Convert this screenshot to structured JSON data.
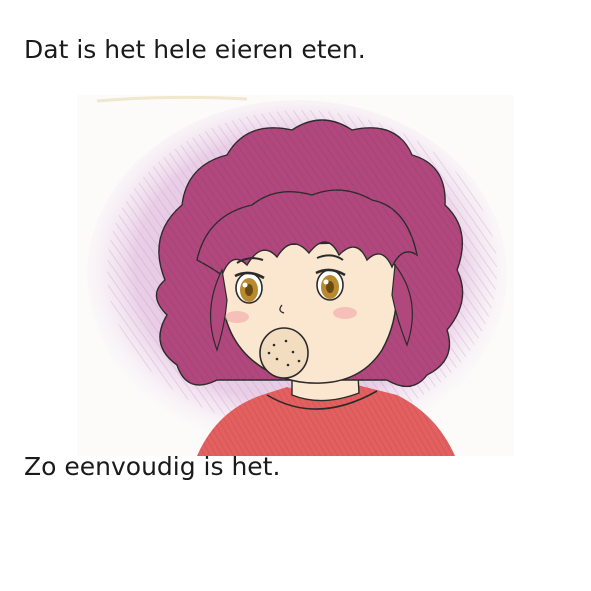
{
  "captions": {
    "top": "Dat is het hele eieren eten.",
    "bottom": "Zo eenvoudig is het."
  },
  "illustration": {
    "subject": "hand-drawn colored-pencil character portrait",
    "icon": "character-portrait",
    "colors": {
      "hair": "#b0487e",
      "hair_shadow": "#8c2f63",
      "background_glow": "#d9a9d6",
      "skin": "#fbe6cf",
      "eyes": "#b8892e",
      "shirt": "#e26060",
      "mouth_food": "#f3ddc0",
      "line": "#2b2b2b"
    }
  }
}
